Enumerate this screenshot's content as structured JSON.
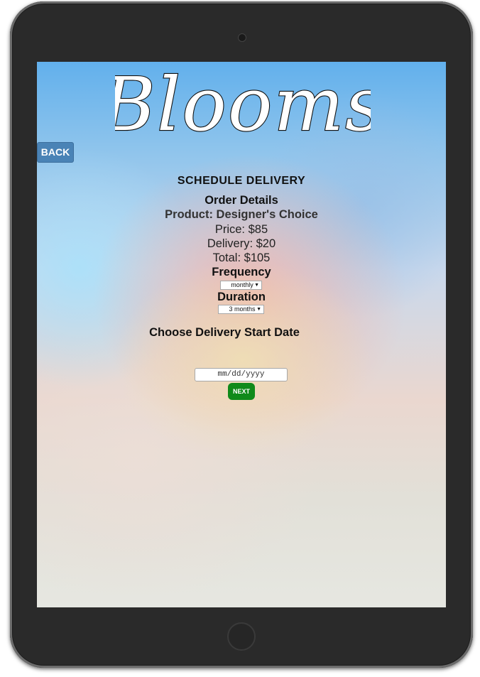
{
  "brand": {
    "logo_text": "Blooms"
  },
  "nav": {
    "back_label": "BACK"
  },
  "page": {
    "title": "SCHEDULE DELIVERY"
  },
  "order": {
    "heading": "Order Details",
    "product": "Product: Designer's Choice",
    "price": "Price: $85",
    "delivery": "Delivery: $20",
    "total": "Total: $105"
  },
  "frequency": {
    "label": "Frequency",
    "selected": "monthly"
  },
  "duration": {
    "label": "Duration",
    "selected": "3 months"
  },
  "start_date": {
    "heading": "Choose Delivery Start Date",
    "placeholder": "mm/dd/yyyy"
  },
  "actions": {
    "next_label": "NEXT"
  },
  "colors": {
    "back_button": "#4a83b6",
    "next_button": "#0f8a1a",
    "device_frame": "#2a2a2a"
  }
}
